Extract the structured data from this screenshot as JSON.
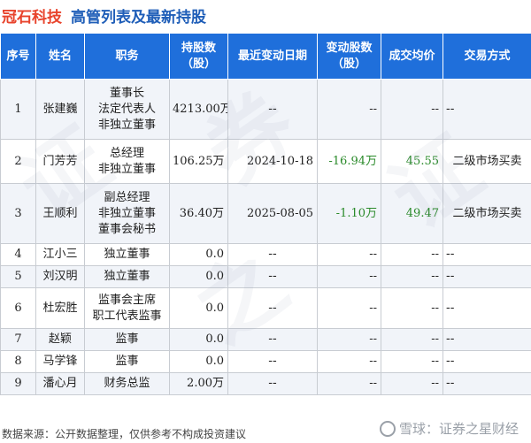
{
  "header": {
    "company": "冠石科技",
    "title": "高管列表及最新持股"
  },
  "table": {
    "columns": [
      "序号",
      "姓名",
      "职务",
      "持股数\n（股）",
      "最近变动日期",
      "变动股数\n（股）",
      "成交均价",
      "交易方式"
    ],
    "rows": [
      {
        "seq": "1",
        "name": "张建巍",
        "roles": [
          "董事长",
          "法定代表人",
          "非独立董事"
        ],
        "shares": "4213.00万",
        "date": "--",
        "change": "--",
        "price": "--",
        "method": "--"
      },
      {
        "seq": "2",
        "name": "门芳芳",
        "roles": [
          "总经理",
          "非独立董事"
        ],
        "shares": "106.25万",
        "date": "2024-10-18",
        "change": "-16.94万",
        "price": "45.55",
        "method": "二级市场买卖"
      },
      {
        "seq": "3",
        "name": "王顺利",
        "roles": [
          "副总经理",
          "非独立董事",
          "董事会秘书"
        ],
        "shares": "36.40万",
        "date": "2025-08-05",
        "change": "-1.10万",
        "price": "49.47",
        "method": "二级市场买卖"
      },
      {
        "seq": "4",
        "name": "江小三",
        "roles": [
          "独立董事"
        ],
        "shares": "0.0",
        "date": "--",
        "change": "--",
        "price": "--",
        "method": "--"
      },
      {
        "seq": "5",
        "name": "刘汉明",
        "roles": [
          "独立董事"
        ],
        "shares": "0.0",
        "date": "--",
        "change": "--",
        "price": "--",
        "method": "--"
      },
      {
        "seq": "6",
        "name": "杜宏胜",
        "roles": [
          "监事会主席",
          "职工代表监事"
        ],
        "shares": "0.0",
        "date": "--",
        "change": "--",
        "price": "--",
        "method": "--"
      },
      {
        "seq": "7",
        "name": "赵颖",
        "roles": [
          "监事"
        ],
        "shares": "0.0",
        "date": "--",
        "change": "--",
        "price": "--",
        "method": "--"
      },
      {
        "seq": "8",
        "name": "马学锋",
        "roles": [
          "监事"
        ],
        "shares": "0.0",
        "date": "--",
        "change": "--",
        "price": "--",
        "method": "--"
      },
      {
        "seq": "9",
        "name": "潘心月",
        "roles": [
          "财务总监"
        ],
        "shares": "2.00万",
        "date": "--",
        "change": "--",
        "price": "--",
        "method": "--"
      }
    ]
  },
  "footer": {
    "source": "数据来源：公开数据整理，仅供参考不构成投资建议",
    "brand": "雪球：证券之星财经"
  },
  "colors": {
    "header_bg": "#1f6fdb",
    "company": "#e8432c",
    "title": "#1f5eb8",
    "negative": "#2a8a2a"
  }
}
